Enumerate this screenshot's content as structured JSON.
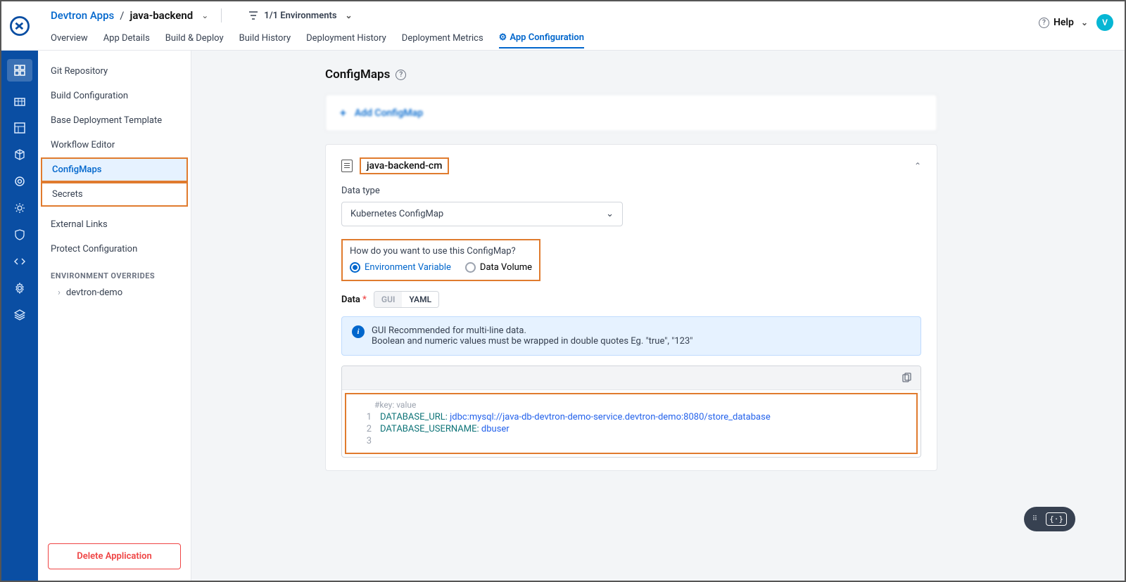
{
  "header": {
    "breadcrumb_parent": "Devtron Apps",
    "breadcrumb_sep": "/",
    "breadcrumb_current": "java-backend",
    "env_label": "1/1 Environments",
    "help_label": "Help",
    "avatar_initial": "V"
  },
  "tabs": {
    "overview": "Overview",
    "app_details": "App Details",
    "build_deploy": "Build & Deploy",
    "build_history": "Build History",
    "deployment_history": "Deployment History",
    "deployment_metrics": "Deployment Metrics",
    "app_config": "App Configuration"
  },
  "sidebar": {
    "git_repo": "Git Repository",
    "build_config": "Build Configuration",
    "base_template": "Base Deployment Template",
    "workflow_editor": "Workflow Editor",
    "configmaps": "ConfigMaps",
    "secrets": "Secrets",
    "external_links": "External Links",
    "protect_config": "Protect Configuration",
    "env_overrides_title": "ENVIRONMENT OVERRIDES",
    "env_1": "devtron-demo",
    "delete_label": "Delete Application"
  },
  "main": {
    "title": "ConfigMaps",
    "add_label": "Add ConfigMap",
    "cm_name": "java-backend-cm",
    "data_type_label": "Data type",
    "data_type_value": "Kubernetes ConfigMap",
    "usage_question": "How do you want to use this ConfigMap?",
    "radio_env": "Environment Variable",
    "radio_vol": "Data Volume",
    "data_label": "Data",
    "toggle_gui": "GUI",
    "toggle_yaml": "YAML",
    "info_line1": "GUI Recommended for multi-line data.",
    "info_line2": "Boolean and numeric values must be wrapped in double quotes Eg. \"true\", \"123\"",
    "code_hint": "#key: value",
    "code_lines": [
      {
        "n": "1",
        "key": "DATABASE_URL",
        "val": "jdbc:mysql://java-db-devtron-demo-service.devtron-demo:8080/store_database"
      },
      {
        "n": "2",
        "key": "DATABASE_USERNAME",
        "val": "dbuser"
      },
      {
        "n": "3",
        "key": "",
        "val": ""
      }
    ]
  }
}
